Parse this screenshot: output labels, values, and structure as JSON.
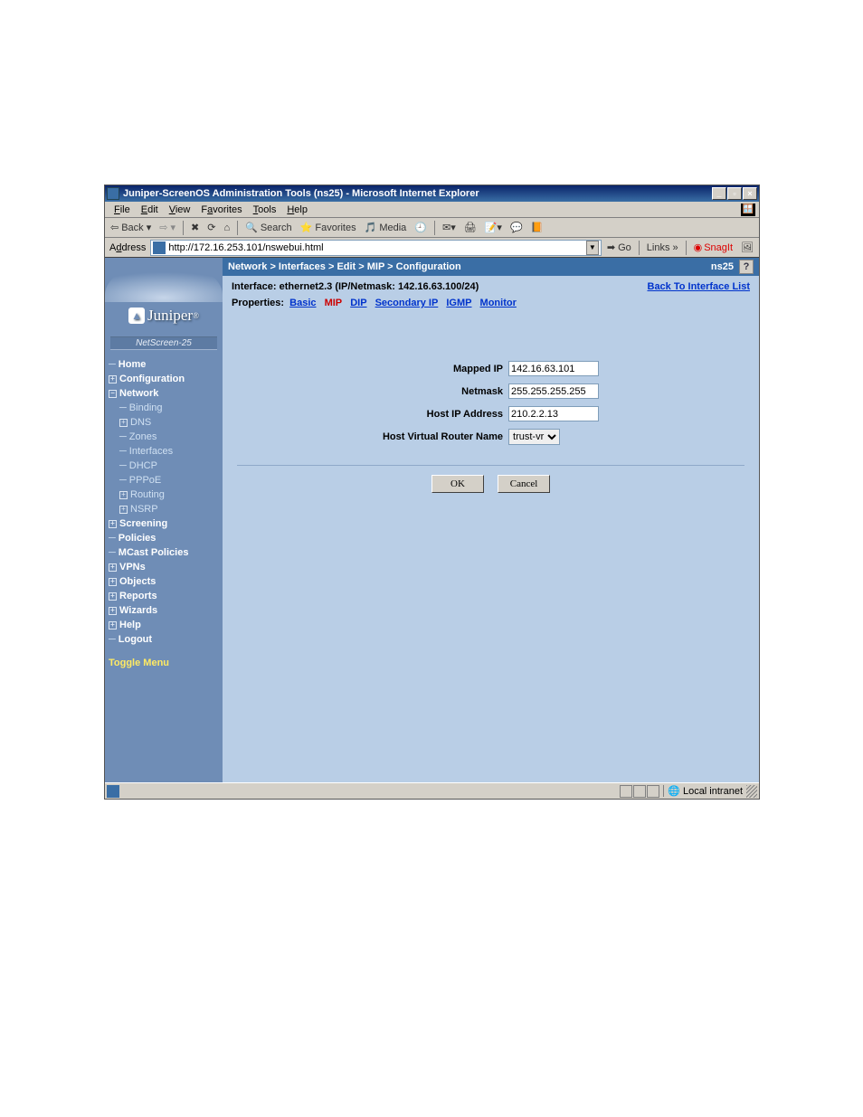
{
  "window": {
    "title": "Juniper-ScreenOS Administration Tools (ns25) - Microsoft Internet Explorer"
  },
  "menubar": {
    "file": "File",
    "edit": "Edit",
    "view": "View",
    "favorites": "Favorites",
    "tools": "Tools",
    "help": "Help"
  },
  "toolbar": {
    "back": "Back",
    "search": "Search",
    "favorites": "Favorites",
    "media": "Media"
  },
  "addressbar": {
    "label": "Address",
    "url": "http://172.16.253.101/nswebui.html",
    "go": "Go",
    "links": "Links",
    "snagit": "SnagIt"
  },
  "sidebar": {
    "brand": "Juniper",
    "device": "NetScreen-25",
    "items": {
      "home": "Home",
      "configuration": "Configuration",
      "network": "Network",
      "binding": "Binding",
      "dns": "DNS",
      "zones": "Zones",
      "interfaces": "Interfaces",
      "dhcp": "DHCP",
      "pppoe": "PPPoE",
      "routing": "Routing",
      "nsrp": "NSRP",
      "screening": "Screening",
      "policies": "Policies",
      "mcast": "MCast Policies",
      "vpns": "VPNs",
      "objects": "Objects",
      "reports": "Reports",
      "wizards": "Wizards",
      "help": "Help",
      "logout": "Logout"
    },
    "toggle": "Toggle Menu"
  },
  "breadcrumb": {
    "path": "Network > Interfaces > Edit > MIP > Configuration",
    "device": "ns25",
    "help": "?"
  },
  "interface_line": "Interface: ethernet2.3 (IP/Netmask: 142.16.63.100/24)",
  "back_link": "Back To Interface List",
  "properties": {
    "label": "Properties:",
    "basic": "Basic",
    "mip": "MIP",
    "dip": "DIP",
    "secondary_ip": "Secondary IP",
    "igmp": "IGMP",
    "monitor": "Monitor"
  },
  "form": {
    "mapped_ip_label": "Mapped IP",
    "mapped_ip_value": "142.16.63.101",
    "netmask_label": "Netmask",
    "netmask_value": "255.255.255.255",
    "host_ip_label": "Host IP Address",
    "host_ip_value": "210.2.2.13",
    "host_vr_label": "Host Virtual Router Name",
    "host_vr_value": "trust-vr",
    "ok": "OK",
    "cancel": "Cancel"
  },
  "statusbar": {
    "zone": "Local intranet"
  }
}
